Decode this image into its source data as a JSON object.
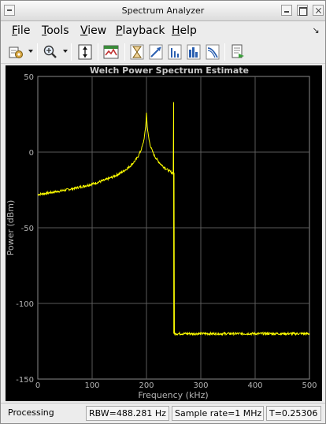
{
  "window": {
    "title": "Spectrum Analyzer"
  },
  "menu": {
    "items": [
      {
        "label": "File",
        "accel": "F",
        "rest": "ile"
      },
      {
        "label": "Tools",
        "accel": "T",
        "rest": "ools"
      },
      {
        "label": "View",
        "accel": "V",
        "rest": "iew"
      },
      {
        "label": "Playback",
        "accel": "P",
        "rest": "layback"
      },
      {
        "label": "Help",
        "accel": "H",
        "rest": "elp"
      }
    ]
  },
  "toolbar": {
    "icons": [
      "settings-icon",
      "zoom-in-icon",
      "scale-axes-icon",
      "spectrum-settings-icon",
      "data-cursors-icon",
      "peak-finder-icon",
      "distortion-measurements-icon",
      "ccdf-icon",
      "generate-script-icon"
    ]
  },
  "chart_data": {
    "type": "line",
    "title": "Welch Power Spectrum Estimate",
    "xlabel": "Frequency (kHz)",
    "ylabel": "Power (dBm)",
    "xlim": [
      0,
      500
    ],
    "ylim": [
      -150,
      50
    ],
    "xticks": [
      0,
      100,
      200,
      300,
      400,
      500
    ],
    "yticks": [
      50,
      0,
      -50,
      -100,
      -150
    ],
    "grid": true,
    "background": "#000000",
    "line_color": "#ffff00",
    "series": [
      {
        "noise_floor_dbm": -120,
        "peaks": [
          {
            "x": 200,
            "y": 26,
            "shape": "lorentzian-skirt"
          },
          {
            "x": 250,
            "y": 33,
            "shape": "narrow-line"
          }
        ]
      }
    ]
  },
  "status": {
    "state": "Processing",
    "rbw": "RBW=488.281 Hz",
    "sample_rate": "Sample rate=1 MHz",
    "time": "T=0.25306"
  },
  "colors": {
    "plot_bg": "#000000",
    "trace": "#ffff00",
    "grid": "#5a5a5a",
    "axis_text": "#b4b4b4"
  }
}
